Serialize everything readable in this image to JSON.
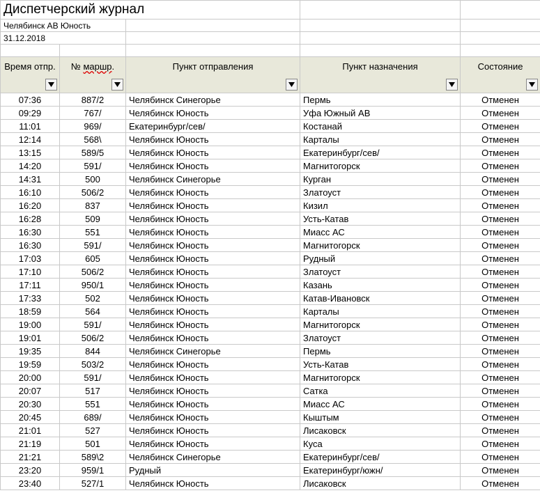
{
  "header": {
    "title": "Диспетчерский журнал",
    "station": "Челябинск АВ Юность",
    "date": "31.12.2018"
  },
  "columns": {
    "time": "Время отпр.",
    "route_pre": "№ ",
    "route_u": "маршр",
    "route_post": ".",
    "departure": "Пункт отправления",
    "destination": "Пункт назначения",
    "status": "Состояние"
  },
  "rows": [
    {
      "time": "07:36",
      "route": "887/2",
      "dep": "Челябинск Синегорье",
      "dest": "Пермь",
      "status": "Отменен"
    },
    {
      "time": "09:29",
      "route": "767/",
      "dep": "Челябинск Юность",
      "dest": "Уфа Южный АВ",
      "status": "Отменен"
    },
    {
      "time": "11:01",
      "route": "969/",
      "dep": "Екатеринбург/сев/",
      "dest": "Костанай",
      "status": "Отменен"
    },
    {
      "time": "12:14",
      "route": "568\\",
      "dep": "Челябинск Юность",
      "dest": "Карталы",
      "status": "Отменен"
    },
    {
      "time": "13:15",
      "route": "589/5",
      "dep": "Челябинск Юность",
      "dest": "Екатеринбург/сев/",
      "status": "Отменен"
    },
    {
      "time": "14:20",
      "route": "591/",
      "dep": "Челябинск Юность",
      "dest": "Магнитогорск",
      "status": "Отменен"
    },
    {
      "time": "14:31",
      "route": "500",
      "dep": "Челябинск Синегорье",
      "dest": "Курган",
      "status": "Отменен"
    },
    {
      "time": "16:10",
      "route": "506/2",
      "dep": "Челябинск Юность",
      "dest": "Златоуст",
      "status": "Отменен"
    },
    {
      "time": "16:20",
      "route": "837",
      "dep": "Челябинск Юность",
      "dest": "Кизил",
      "status": "Отменен"
    },
    {
      "time": "16:28",
      "route": "509",
      "dep": "Челябинск Юность",
      "dest": "Усть-Катав",
      "status": "Отменен"
    },
    {
      "time": "16:30",
      "route": "551",
      "dep": "Челябинск Юность",
      "dest": "Миасс АС",
      "status": "Отменен"
    },
    {
      "time": "16:30",
      "route": "591/",
      "dep": "Челябинск Юность",
      "dest": "Магнитогорск",
      "status": "Отменен"
    },
    {
      "time": "17:03",
      "route": "605",
      "dep": "Челябинск Юность",
      "dest": "Рудный",
      "status": "Отменен"
    },
    {
      "time": "17:10",
      "route": "506/2",
      "dep": "Челябинск Юность",
      "dest": "Златоуст",
      "status": "Отменен"
    },
    {
      "time": "17:11",
      "route": "950/1",
      "dep": "Челябинск Юность",
      "dest": "Казань",
      "status": "Отменен"
    },
    {
      "time": "17:33",
      "route": "502",
      "dep": "Челябинск Юность",
      "dest": "Катав-Ивановск",
      "status": "Отменен"
    },
    {
      "time": "18:59",
      "route": "564",
      "dep": "Челябинск Юность",
      "dest": "Карталы",
      "status": "Отменен"
    },
    {
      "time": "19:00",
      "route": "591/",
      "dep": "Челябинск Юность",
      "dest": "Магнитогорск",
      "status": "Отменен"
    },
    {
      "time": "19:01",
      "route": "506/2",
      "dep": "Челябинск Юность",
      "dest": "Златоуст",
      "status": "Отменен"
    },
    {
      "time": "19:35",
      "route": "844",
      "dep": "Челябинск Синегорье",
      "dest": "Пермь",
      "status": "Отменен"
    },
    {
      "time": "19:59",
      "route": "503/2",
      "dep": "Челябинск Юность",
      "dest": "Усть-Катав",
      "status": "Отменен"
    },
    {
      "time": "20:00",
      "route": "591/",
      "dep": "Челябинск Юность",
      "dest": "Магнитогорск",
      "status": "Отменен"
    },
    {
      "time": "20:07",
      "route": "517",
      "dep": "Челябинск Юность",
      "dest": "Сатка",
      "status": "Отменен"
    },
    {
      "time": "20:30",
      "route": "551",
      "dep": "Челябинск Юность",
      "dest": "Миасс АС",
      "status": "Отменен"
    },
    {
      "time": "20:45",
      "route": "689/",
      "dep": "Челябинск Юность",
      "dest": "Кыштым",
      "status": "Отменен"
    },
    {
      "time": "21:01",
      "route": "527",
      "dep": "Челябинск Юность",
      "dest": "Лисаковск",
      "status": "Отменен"
    },
    {
      "time": "21:19",
      "route": "501",
      "dep": "Челябинск Юность",
      "dest": "Куса",
      "status": "Отменен"
    },
    {
      "time": "21:21",
      "route": "589\\2",
      "dep": "Челябинск Синегорье",
      "dest": "Екатеринбург/сев/",
      "status": "Отменен"
    },
    {
      "time": "23:20",
      "route": "959/1",
      "dep": "Рудный",
      "dest": "Екатеринбург/южн/",
      "status": "Отменен"
    },
    {
      "time": "23:40",
      "route": "527/1",
      "dep": "Челябинск Юность",
      "dest": "Лисаковск",
      "status": "Отменен"
    }
  ]
}
